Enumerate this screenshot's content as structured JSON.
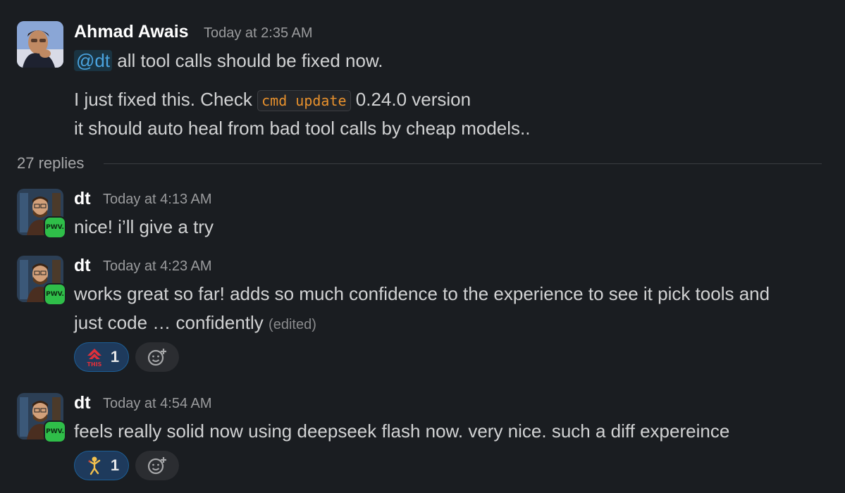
{
  "messages": [
    {
      "author": "Ahmad Awais",
      "time": "Today at 2:35 AM",
      "mention": "@dt",
      "line1_rest": " all tool calls should be fixed now.",
      "line2_pre": "I just fixed this. Check ",
      "code": "cmd update",
      "line2_post": " 0.24.0 version",
      "line3": "it should auto heal from bad tool calls by cheap models.."
    },
    {
      "author": "dt",
      "time": "Today at 4:13 AM",
      "text": "nice! i’ll give a try",
      "badge": "PWV."
    },
    {
      "author": "dt",
      "time": "Today at 4:23 AM",
      "line1": "works great so far! adds so much confidence to the experience to see it pick tools and",
      "line2": "just code … confidently",
      "edited": "(edited)",
      "badge": "PWV.",
      "reaction": {
        "emoji_name": "this-arrow-emoji",
        "count": "1"
      }
    },
    {
      "author": "dt",
      "time": "Today at 4:54 AM",
      "text": "feels really solid now using deepseek flash now. very nice. such a diff expereince",
      "badge": "PWV.",
      "reaction": {
        "emoji_name": "dancing-figure-emoji",
        "count": "1"
      }
    }
  ],
  "thread": {
    "replies": "27 replies"
  },
  "colors": {
    "background": "#1a1d21",
    "mention": "#4aa3df",
    "code": "#e8912d",
    "badge": "#2fbe49",
    "reaction_bg": "#1e3a5c"
  }
}
